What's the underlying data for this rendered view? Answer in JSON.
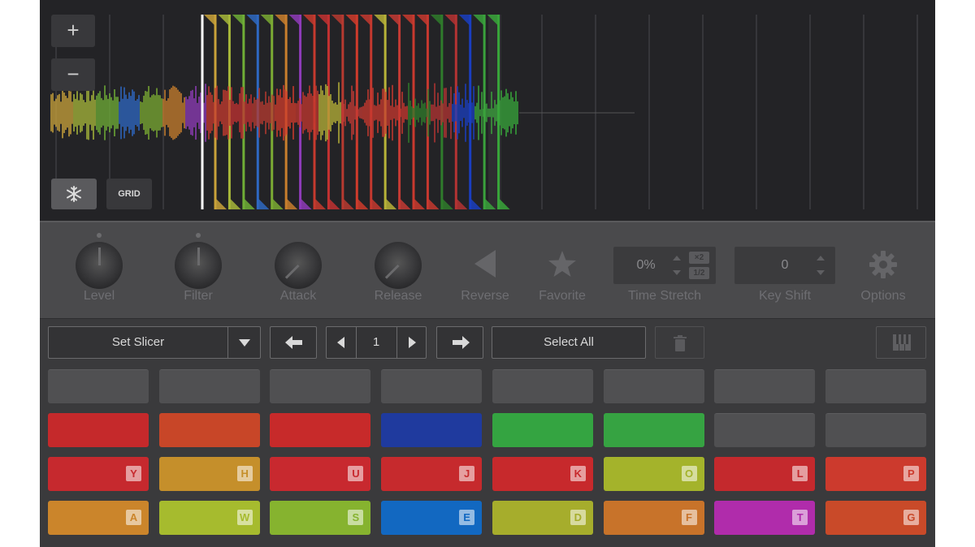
{
  "waveform": {
    "zoom_in_label": "+",
    "zoom_out_label": "−",
    "grid_label": "GRID",
    "snowflake_icon": "snowflake-icon",
    "slice_colors": [
      "#c9a23a",
      "#a7b73a",
      "#6fae36",
      "#2e68c2",
      "#7aaa33",
      "#c87e2d",
      "#8e3bb8",
      "#c63a2e",
      "#c23131",
      "#b73a30",
      "#cf3b2c",
      "#c4382f",
      "#b7b238",
      "#c43a34",
      "#c9392e",
      "#c7382f",
      "#2f7b2b",
      "#b43333",
      "#1a3ec0",
      "#3aa23c",
      "#38a63a"
    ]
  },
  "controls": {
    "level": {
      "label": "Level"
    },
    "filter": {
      "label": "Filter"
    },
    "attack": {
      "label": "Attack"
    },
    "release": {
      "label": "Release"
    },
    "reverse": {
      "label": "Reverse"
    },
    "favorite": {
      "label": "Favorite"
    },
    "time_stretch": {
      "label": "Time Stretch",
      "value": "0%",
      "mult_label": "×2",
      "div_label": "1/2"
    },
    "key_shift": {
      "label": "Key Shift",
      "value": "0"
    },
    "options": {
      "label": "Options"
    }
  },
  "toolbar": {
    "mode_select": "Set Slicer",
    "page_number": "1",
    "select_all": "Select All"
  },
  "pads": {
    "row1": [
      {
        "color": "#505052"
      },
      {
        "color": "#505052"
      },
      {
        "color": "#505052"
      },
      {
        "color": "#505052"
      },
      {
        "color": "#505052"
      },
      {
        "color": "#505052"
      },
      {
        "color": "#505052"
      },
      {
        "color": "#505052"
      }
    ],
    "row2": [
      {
        "color": "#c5292b"
      },
      {
        "color": "#c84628"
      },
      {
        "color": "#c72a2a"
      },
      {
        "color": "#1f3a9e"
      },
      {
        "color": "#34a441"
      },
      {
        "color": "#36a342"
      },
      {
        "color": "#505052"
      },
      {
        "color": "#505052"
      }
    ],
    "row3": [
      {
        "color": "#c6292e",
        "key": "Y"
      },
      {
        "color": "#c58f2b",
        "key": "H"
      },
      {
        "color": "#c8292f",
        "key": "U"
      },
      {
        "color": "#c62a2d",
        "key": "J"
      },
      {
        "color": "#c7292c",
        "key": "K"
      },
      {
        "color": "#a4b32b",
        "key": "O"
      },
      {
        "color": "#c4292d",
        "key": "L"
      },
      {
        "color": "#cc3a2d",
        "key": "P"
      }
    ],
    "row4": [
      {
        "color": "#cb852b",
        "key": "A"
      },
      {
        "color": "#a6bb2e",
        "key": "W"
      },
      {
        "color": "#86b32f",
        "key": "S"
      },
      {
        "color": "#1268c1",
        "key": "E"
      },
      {
        "color": "#a6ad2c",
        "key": "D"
      },
      {
        "color": "#c8732a",
        "key": "F"
      },
      {
        "color": "#b02cab",
        "key": "T"
      },
      {
        "color": "#c94a29",
        "key": "G"
      }
    ]
  }
}
